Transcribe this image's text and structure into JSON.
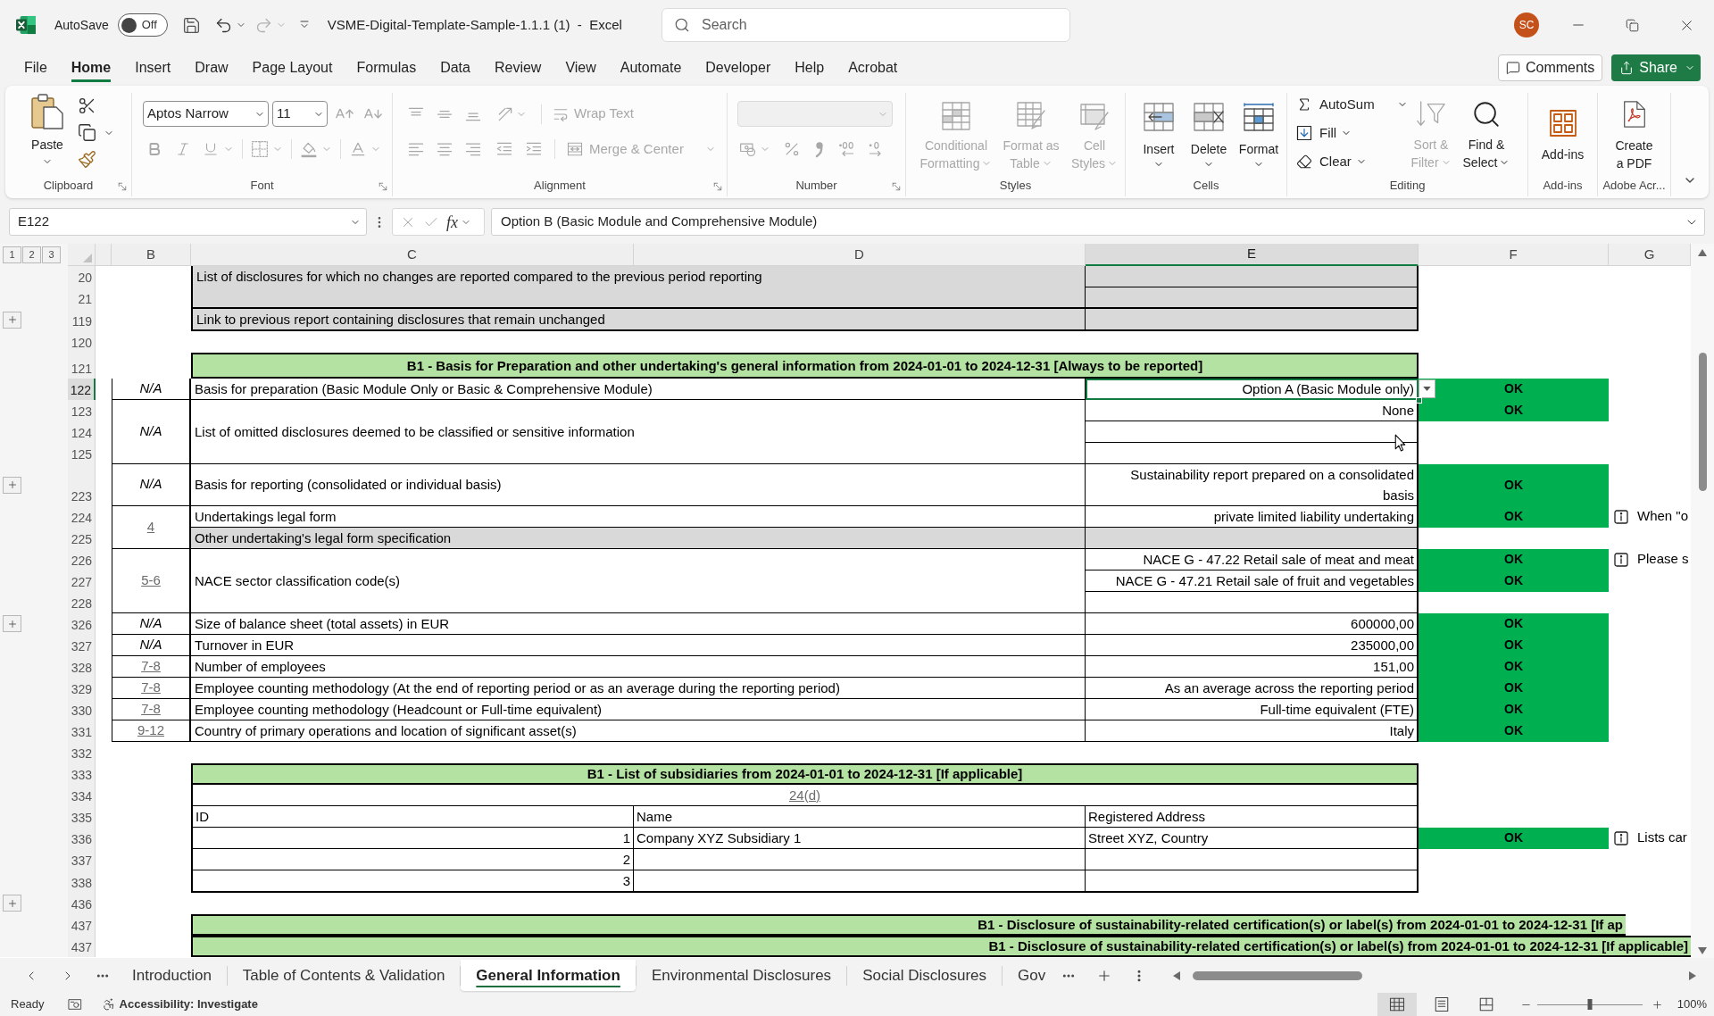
{
  "title_bar": {
    "autosave": {
      "label": "AutoSave",
      "on": false,
      "state_text": "Off"
    },
    "title": "VSME-Digital-Template-Sample-1.1.1 (1)  -  Excel",
    "search": {
      "placeholder": "Search"
    },
    "avatar_initials": "SC"
  },
  "menu_tabs": [
    {
      "label": "File",
      "selected": false
    },
    {
      "label": "Home",
      "selected": true
    },
    {
      "label": "Insert",
      "selected": false
    },
    {
      "label": "Draw",
      "selected": false
    },
    {
      "label": "Page Layout",
      "selected": false
    },
    {
      "label": "Formulas",
      "selected": false
    },
    {
      "label": "Data",
      "selected": false
    },
    {
      "label": "Review",
      "selected": false
    },
    {
      "label": "View",
      "selected": false
    },
    {
      "label": "Automate",
      "selected": false
    },
    {
      "label": "Developer",
      "selected": false
    },
    {
      "label": "Help",
      "selected": false
    },
    {
      "label": "Acrobat",
      "selected": false
    }
  ],
  "comments_button": {
    "label": "Comments"
  },
  "share_button": {
    "label": "Share"
  },
  "ribbon": {
    "clipboard": {
      "label": "Clipboard",
      "paste": {
        "label": "Paste"
      }
    },
    "font": {
      "label": "Font",
      "font_name": "Aptos Narrow",
      "font_size": "11",
      "buttons_disabled": true
    },
    "alignment": {
      "label": "Alignment",
      "disabled": true,
      "wrap_text": "Wrap Text",
      "merge_center": "Merge & Center"
    },
    "number": {
      "label": "Number",
      "disabled": true
    },
    "styles": {
      "label": "Styles",
      "items": [
        {
          "label": "Conditional Formatting",
          "disabled": true
        },
        {
          "label": "Format as Table",
          "disabled": true
        },
        {
          "label": "Cell Styles",
          "disabled": true
        }
      ]
    },
    "cells": {
      "label": "Cells",
      "items": [
        {
          "label": "Insert",
          "disabled": false
        },
        {
          "label": "Delete",
          "disabled": false
        },
        {
          "label": "Format",
          "disabled": false
        }
      ]
    },
    "editing": {
      "label": "Editing",
      "small_items": [
        {
          "label": "AutoSum",
          "disabled": false
        },
        {
          "label": "Fill",
          "disabled": false
        },
        {
          "label": "Clear",
          "disabled": false
        }
      ],
      "large_items": [
        {
          "label": "Sort & Filter",
          "disabled": true
        },
        {
          "label": "Find & Select",
          "disabled": false
        }
      ]
    },
    "addins": {
      "label": "Add-ins",
      "button": "Add-ins"
    },
    "adobe": {
      "label": "Adobe Acr...",
      "button": "Create a PDF"
    }
  },
  "formula_bar": {
    "name_box": "E122",
    "function_label": "fx",
    "formula": "Option B (Basic Module and Comprehensive Module)"
  },
  "outline_levels": [
    "1",
    "2",
    "3"
  ],
  "columns": [
    {
      "label": "B",
      "selected": false
    },
    {
      "label": "C",
      "selected": false
    },
    {
      "label": "D",
      "selected": false
    },
    {
      "label": "E",
      "selected": true
    },
    {
      "label": "F",
      "selected": false
    },
    {
      "label": "G",
      "selected": false
    }
  ],
  "rows": [
    {
      "number": "20",
      "selected": false,
      "expand_button": false
    },
    {
      "number": "21",
      "selected": false,
      "expand_button": false
    },
    {
      "number": "119",
      "selected": false,
      "expand_button": true
    },
    {
      "number": "120",
      "selected": false,
      "expand_button": false
    },
    {
      "number": "121",
      "selected": false,
      "expand_button": false
    },
    {
      "number": "122",
      "selected": true,
      "expand_button": false
    },
    {
      "number": "123",
      "selected": false,
      "expand_button": false
    },
    {
      "number": "124",
      "selected": false,
      "expand_button": false
    },
    {
      "number": "125",
      "selected": false,
      "expand_button": false
    },
    {
      "number": "223",
      "selected": false,
      "expand_button": true
    },
    {
      "number": "224",
      "selected": false,
      "expand_button": false
    },
    {
      "number": "225",
      "selected": false,
      "expand_button": false
    },
    {
      "number": "226",
      "selected": false,
      "expand_button": false
    },
    {
      "number": "227",
      "selected": false,
      "expand_button": false
    },
    {
      "number": "228",
      "selected": false,
      "expand_button": false
    },
    {
      "number": "326",
      "selected": false,
      "expand_button": true
    },
    {
      "number": "327",
      "selected": false,
      "expand_button": false
    },
    {
      "number": "328",
      "selected": false,
      "expand_button": false
    },
    {
      "number": "329",
      "selected": false,
      "expand_button": false
    },
    {
      "number": "330",
      "selected": false,
      "expand_button": false
    },
    {
      "number": "331",
      "selected": false,
      "expand_button": false
    },
    {
      "number": "332",
      "selected": false,
      "expand_button": false
    },
    {
      "number": "333",
      "selected": false,
      "expand_button": false
    },
    {
      "number": "334",
      "selected": false,
      "expand_button": false
    },
    {
      "number": "335",
      "selected": false,
      "expand_button": false
    },
    {
      "number": "336",
      "selected": false,
      "expand_button": false
    },
    {
      "number": "337",
      "selected": false,
      "expand_button": false
    },
    {
      "number": "338",
      "selected": false,
      "expand_button": false
    },
    {
      "number": "436",
      "selected": false,
      "expand_button": true
    },
    {
      "number": "437",
      "selected": false,
      "expand_button": false
    },
    {
      "number": "437",
      "selected": false,
      "expand_button": false
    }
  ],
  "blocks": [
    {
      "kind": "grey_item",
      "shaded": true,
      "label": "List of disclosures for which no changes are reported compared to the previous period reporting",
      "lines": [
        {
          "selected": false,
          "shaded": true
        },
        {
          "selected": false,
          "shaded": true
        }
      ]
    },
    {
      "kind": "grey_item",
      "shaded": true,
      "label": "Link to previous report containing disclosures that remain unchanged",
      "lines": [
        {
          "selected": false,
          "shaded": true
        }
      ]
    },
    {
      "kind": "blank"
    },
    {
      "kind": "section_header",
      "text": "B1 - Basis for Preparation and other undertaking's general information from 2024-01-01 to 2024-12-31 [Always to be reported]"
    },
    {
      "kind": "item",
      "ref": {
        "text": "N/A",
        "link": false
      },
      "label": "Basis for preparation (Basic Module Only or Basic & Comprehensive Module)",
      "lines": [
        {
          "value": "Option A (Basic Module only)",
          "status": "OK",
          "selected": true,
          "shaded": false
        }
      ]
    },
    {
      "kind": "item",
      "ref": {
        "text": "N/A",
        "link": false
      },
      "label": "List of omitted disclosures deemed to be classified or sensitive information",
      "lines": [
        {
          "value": "None",
          "status": "OK",
          "selected": false,
          "shaded": false
        },
        {
          "selected": false,
          "shaded": false
        },
        {
          "selected": false,
          "shaded": false
        }
      ]
    },
    {
      "kind": "item",
      "ref": {
        "text": "N/A",
        "link": false
      },
      "label": "Basis for reporting (consolidated or individual basis)",
      "lines": [
        {
          "value": "Sustainability report prepared on a consolidated basis",
          "status": "OK",
          "selected": false,
          "shaded": false
        }
      ]
    },
    {
      "kind": "item",
      "ref": {
        "text": "4",
        "link": true
      },
      "lines": [
        {
          "label": "Undertakings legal form",
          "value": "private limited liability undertaking",
          "status": "OK",
          "note": "When \"o",
          "selected": false,
          "shaded": false
        },
        {
          "label": "Other undertaking's legal form specification",
          "selected": false,
          "shaded": true
        }
      ]
    },
    {
      "kind": "item",
      "ref": {
        "text": "5-6",
        "link": true
      },
      "label": "NACE sector classification code(s)",
      "lines": [
        {
          "value": "NACE G - 47.22 Retail sale of meat and meat",
          "status": "OK",
          "note": "Please s",
          "selected": false,
          "shaded": false
        },
        {
          "value": "NACE G - 47.21 Retail sale of fruit and vegetables",
          "status": "OK",
          "selected": false,
          "shaded": false
        },
        {
          "selected": false,
          "shaded": false
        }
      ]
    },
    {
      "kind": "item",
      "ref": {
        "text": "N/A",
        "link": false
      },
      "label": "Size of balance sheet (total assets) in EUR",
      "lines": [
        {
          "value": "600000,00",
          "status": "OK",
          "selected": false,
          "shaded": false
        }
      ]
    },
    {
      "kind": "item",
      "ref": {
        "text": "N/A",
        "link": false
      },
      "label": "Turnover in EUR",
      "lines": [
        {
          "value": "235000,00",
          "status": "OK",
          "selected": false,
          "shaded": false
        }
      ]
    },
    {
      "kind": "item",
      "ref": {
        "text": "7-8",
        "link": true
      },
      "label": "Number of employees",
      "lines": [
        {
          "value": "151,00",
          "status": "OK",
          "selected": false,
          "shaded": false
        }
      ]
    },
    {
      "kind": "item",
      "ref": {
        "text": "7-8",
        "link": true
      },
      "label": "Employee counting methodology (At the end of reporting period or as an average during the reporting period)",
      "lines": [
        {
          "value": "As an average across the reporting period",
          "status": "OK",
          "selected": false,
          "shaded": false
        }
      ]
    },
    {
      "kind": "item",
      "ref": {
        "text": "7-8",
        "link": true
      },
      "label": "Employee counting methodology (Headcount or Full-time equivalent)",
      "lines": [
        {
          "value": "Full-time equivalent (FTE)",
          "status": "OK",
          "selected": false,
          "shaded": false
        }
      ]
    },
    {
      "kind": "item",
      "ref": {
        "text": "9-12",
        "link": true
      },
      "label": "Country of primary operations and location of significant asset(s)",
      "lines": [
        {
          "value": "Italy",
          "status": "OK",
          "selected": false,
          "shaded": false
        }
      ]
    },
    {
      "kind": "blank"
    },
    {
      "kind": "table",
      "title": "B1 - List of subsidiaries from 2024-01-01 to 2024-12-31 [If applicable]",
      "ref": {
        "text": "24(d)",
        "link": true
      },
      "columns": [
        "ID",
        "Name",
        "Registered Address"
      ],
      "rows": [
        {
          "cells": [
            "1",
            "Company XYZ Subsidiary 1",
            "Street XYZ, Country"
          ],
          "status": "OK",
          "note": "Lists car"
        },
        {
          "cells": [
            "2"
          ]
        },
        {
          "cells": [
            "3"
          ]
        }
      ]
    },
    {
      "kind": "blank"
    },
    {
      "kind": "wide_header",
      "cut_off": true,
      "text": "B1 - Disclosure of sustainability-related certification(s) or label(s) from 2024-01-01 to 2024-12-31 [If ap"
    },
    {
      "kind": "wide_header",
      "cut_off": false,
      "text": "B1 - Disclosure of sustainability-related certification(s) or label(s) from 2024-01-01 to 2024-12-31 [If applicable]"
    }
  ],
  "sheet_tabs": [
    {
      "label": "Introduction",
      "selected": false
    },
    {
      "label": "Table of Contents & Validation",
      "selected": false
    },
    {
      "label": "General Information",
      "selected": true
    },
    {
      "label": "Environmental Disclosures",
      "selected": false
    },
    {
      "label": "Social Disclosures",
      "selected": false
    },
    {
      "label": "Gov",
      "selected": false
    }
  ],
  "status_bar": {
    "status": "Ready",
    "accessibility": "Accessibility: Investigate",
    "view_modes": [
      {
        "selected": true
      },
      {
        "selected": false
      },
      {
        "selected": false
      }
    ],
    "zoom": {
      "level": 0.5,
      "label": "100%"
    }
  }
}
